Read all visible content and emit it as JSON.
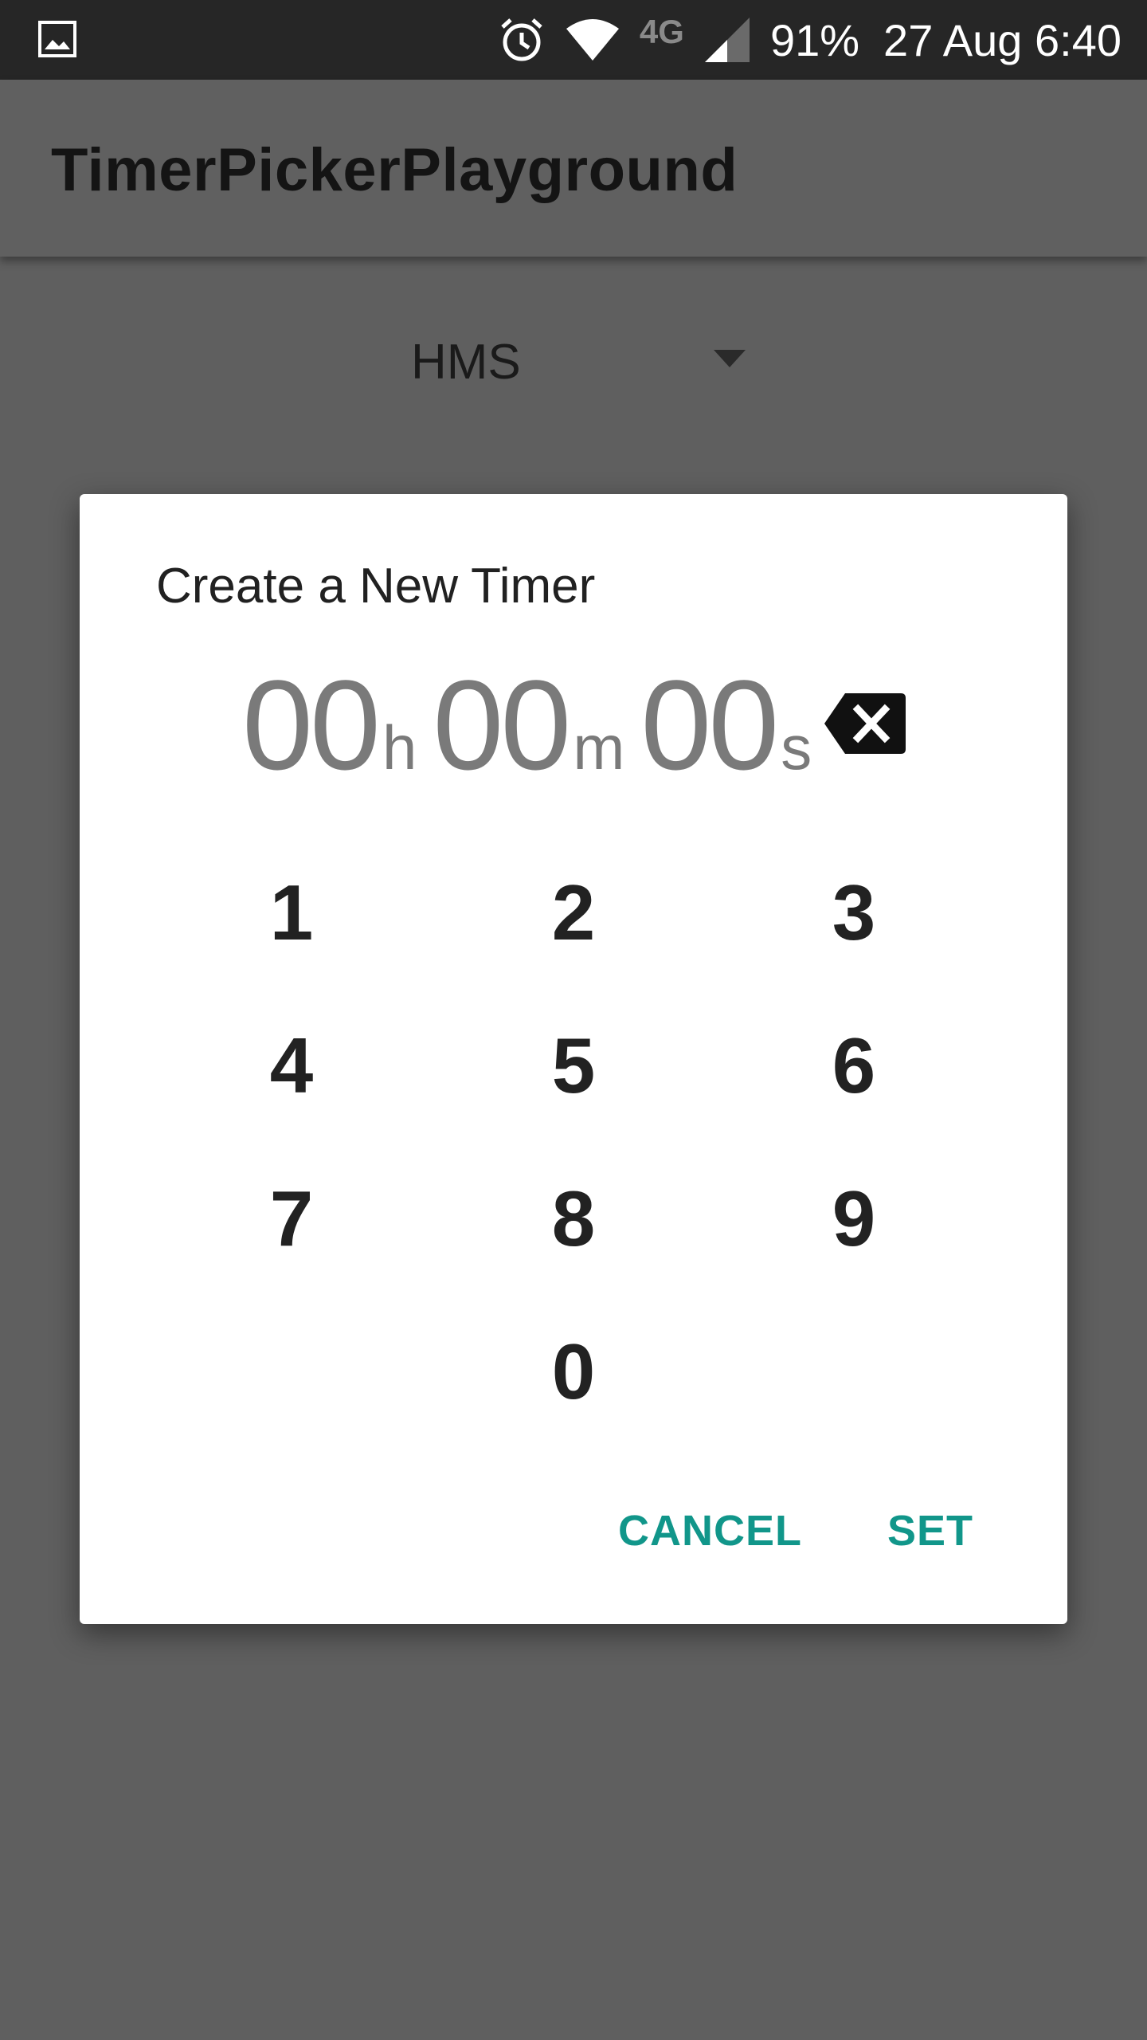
{
  "status_bar": {
    "battery": "91%",
    "datetime": "27 Aug 6:40",
    "network": "4G",
    "icons": [
      "gallery-icon",
      "alarm-icon",
      "wifi-icon",
      "4g-lte-icon",
      "signal-icon"
    ]
  },
  "app_bar": {
    "title": "TimerPickerPlayground"
  },
  "spinner": {
    "selected": "HMS"
  },
  "dialog": {
    "title": "Create a New Timer",
    "time": {
      "hours": "00",
      "hours_unit": "h",
      "minutes": "00",
      "minutes_unit": "m",
      "seconds": "00",
      "seconds_unit": "s"
    },
    "keys": [
      "1",
      "2",
      "3",
      "4",
      "5",
      "6",
      "7",
      "8",
      "9",
      "0"
    ],
    "cancel_label": "CANCEL",
    "set_label": "SET"
  },
  "colors": {
    "accent": "#11968a",
    "scrim_background": "#5f5f5f",
    "status_bar": "#262626"
  }
}
